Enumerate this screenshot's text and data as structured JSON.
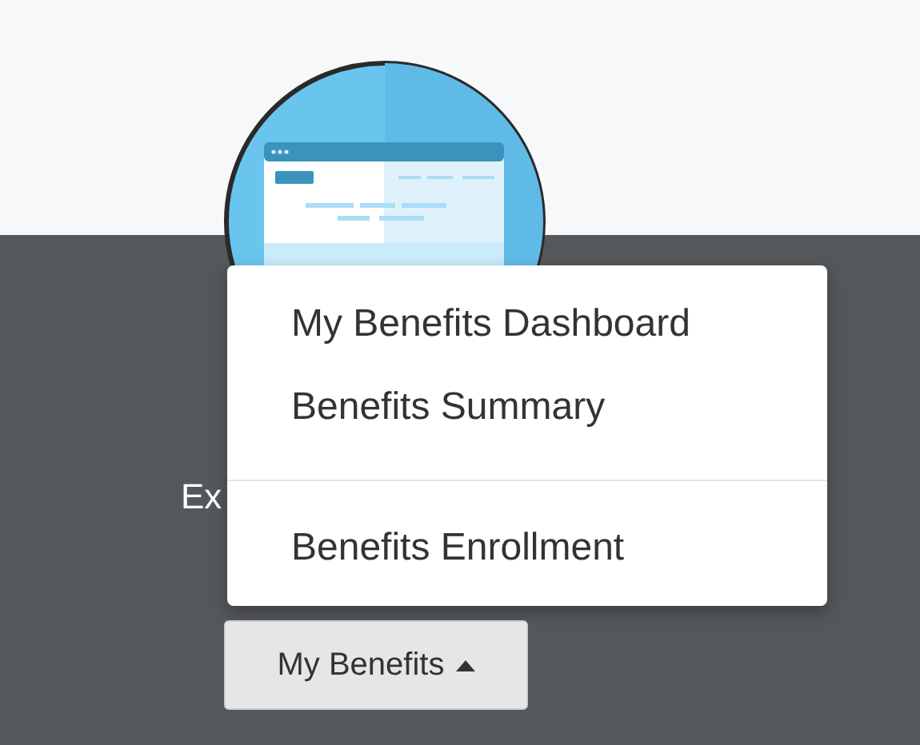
{
  "background_text": "Ex",
  "menu": {
    "items": [
      {
        "kind": "item",
        "label": "My Benefits Dashboard"
      },
      {
        "kind": "item",
        "label": "Benefits Summary"
      },
      {
        "kind": "divider"
      },
      {
        "kind": "item",
        "label": "Benefits Enrollment"
      }
    ]
  },
  "dropdown_button": {
    "label": "My Benefits",
    "expanded": true
  }
}
